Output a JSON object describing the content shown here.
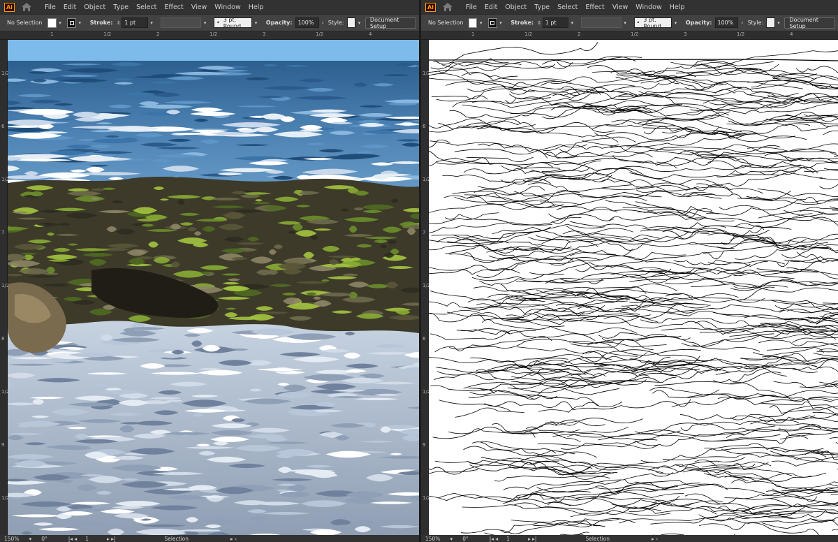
{
  "app": {
    "logo": "Ai",
    "menu": [
      "File",
      "Edit",
      "Object",
      "Type",
      "Select",
      "Effect",
      "View",
      "Window",
      "Help"
    ]
  },
  "control": {
    "selection": "No Selection",
    "stroke_label": "Stroke:",
    "stroke_value": "1 pt",
    "brush": "3 pt. Round",
    "opacity_label": "Opacity:",
    "opacity_value": "100%",
    "style_label": "Style:",
    "doc_setup": "Document Setup"
  },
  "rulers": {
    "h_left": [
      "1",
      "1/2",
      "2",
      "1/2",
      "3",
      "1/2",
      "4"
    ],
    "h_right": [
      "1",
      "1/2",
      "2",
      "1/2",
      "3",
      "1/2",
      "4"
    ],
    "v_left": [
      "1/2",
      "6",
      "1/2",
      "7",
      "1/2",
      "8",
      "1/2",
      "9",
      "1/2"
    ],
    "v_right": [
      "1/2",
      "6",
      "1/2",
      "7",
      "1/2",
      "8",
      "1/2",
      "9",
      "1/2"
    ]
  },
  "status": {
    "zoom": "150%",
    "rotation": "0°",
    "artboard": "1",
    "tool": "Selection"
  },
  "colors": {
    "sky": "#7dbbeb",
    "sea_deep": "#2d5f8e",
    "sea_mid": "#4c82b3",
    "foam": "#e6eef5",
    "moss": "#6b8f2a",
    "rock": "#3d3a2a"
  },
  "icons": {
    "home": "home-icon",
    "chevron": "chevron-down-icon"
  }
}
